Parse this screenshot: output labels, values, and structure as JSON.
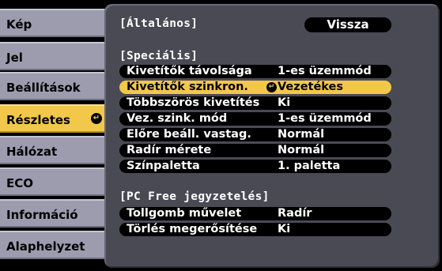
{
  "sidebar": {
    "items": [
      {
        "label": "Kép"
      },
      {
        "label": "Jel"
      },
      {
        "label": "Beállítások"
      },
      {
        "label": "Részletes",
        "active": true
      },
      {
        "label": "Hálózat"
      },
      {
        "label": "ECO"
      },
      {
        "label": "Információ"
      },
      {
        "label": "Alaphelyzet"
      }
    ]
  },
  "panel": {
    "header": "[Általános]",
    "back_label": "Vissza",
    "sections": [
      {
        "title": "[Speciális]",
        "rows": [
          {
            "label": "Kivetítők távolsága",
            "value": "1-es üzemmód"
          },
          {
            "label": "Kivetítők szinkron.",
            "value": "Vezetékes",
            "selected": true
          },
          {
            "label": "Többszörös kivetítés",
            "value": "Ki"
          },
          {
            "label": "Vez. szink. mód",
            "value": "1-es üzemmód"
          },
          {
            "label": "Előre beáll. vastag.",
            "value": "Normál"
          },
          {
            "label": "Radír mérete",
            "value": "Normál"
          },
          {
            "label": "Színpaletta",
            "value": "1. paletta"
          }
        ]
      },
      {
        "title": "[PC Free jegyzetelés]",
        "rows": [
          {
            "label": "Tollgomb művelet",
            "value": "Radír"
          },
          {
            "label": "Törlés megerősítése",
            "value": "Ki"
          }
        ]
      }
    ]
  },
  "colors": {
    "highlight": "#f2c84b",
    "sidebar_tab": "#9c9cae",
    "panel_bg": "#4a4a55"
  },
  "icons": {
    "enter": "enter-arrow-icon"
  }
}
